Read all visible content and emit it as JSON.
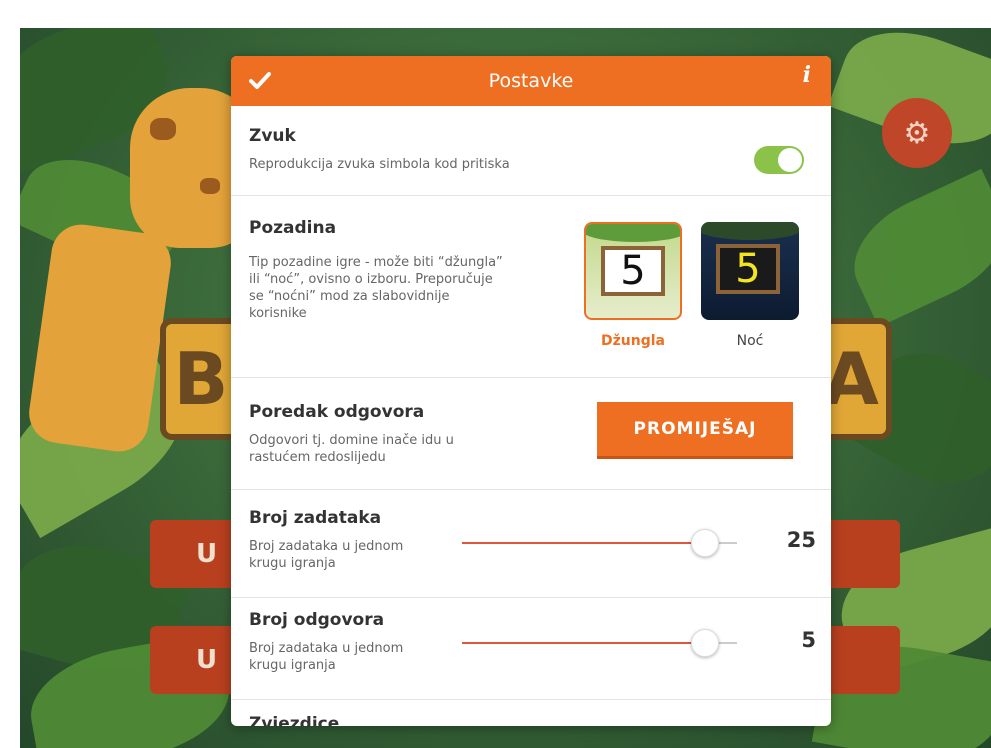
{
  "background": {
    "title_letters": [
      "B",
      "A"
    ],
    "menu_button_prefix": [
      "U",
      "U"
    ],
    "gear_icon": "gear-icon"
  },
  "dialog": {
    "title": "Postavke",
    "confirm_icon": "check-icon",
    "info_label": "i",
    "accent_color": "#ef6f22"
  },
  "sound": {
    "name": "Zvuk",
    "desc": "Reprodukcija zvuka simbola kod pritiska",
    "enabled": true
  },
  "background_setting": {
    "name": "Pozadina",
    "desc_lines": [
      "Tip pozadine igre - može biti “džungla”",
      "ili “noć”, ovisno o izboru. Preporučuje",
      "se “noćni” mod za slabovidnije",
      "korisnike"
    ],
    "options": [
      {
        "label": "Džungla",
        "preview_number": "5",
        "selected": true
      },
      {
        "label": "Noć",
        "preview_number": "5",
        "selected": false
      }
    ]
  },
  "order": {
    "name": "Poredak odgovora",
    "desc_lines": [
      "Odgovori tj. domine inače idu u",
      "rastućem redoslijedu"
    ],
    "button_label": "PROMIJEŠAJ"
  },
  "task_count": {
    "name": "Broj zadataka",
    "desc_lines": [
      "Broj zadataka u jednom",
      "krugu igranja"
    ],
    "value": "25",
    "slider_fraction": 0.88
  },
  "answer_count": {
    "name": "Broj odgovora",
    "desc_lines": [
      "Broj zadataka u jednom",
      "krugu igranja"
    ],
    "value": "5",
    "slider_fraction": 0.88
  },
  "stars": {
    "name": "Zvjezdice"
  }
}
